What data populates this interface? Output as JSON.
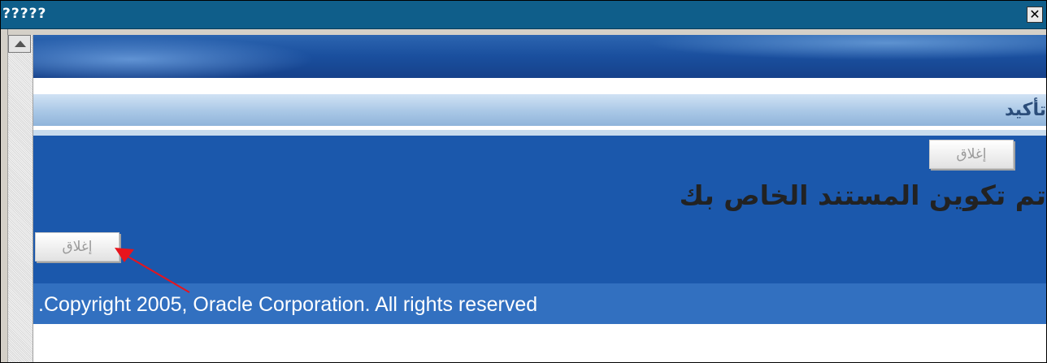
{
  "window": {
    "title": "?????",
    "close_glyph": "✕",
    "close_icon": "close-icon"
  },
  "page": {
    "header_title": "تأكيد",
    "top_button_label": "إغلاق",
    "message": "تم تكوين المستند الخاص بك",
    "bottom_button_label": "إغلاق",
    "copyright": ".Copyright 2005, Oracle Corporation. All rights reserved"
  },
  "colors": {
    "titlebar": "#0f5e8a",
    "main_background": "#1b58ac",
    "footer_background": "#3270c0",
    "annotation_arrow": "#e8141c"
  }
}
